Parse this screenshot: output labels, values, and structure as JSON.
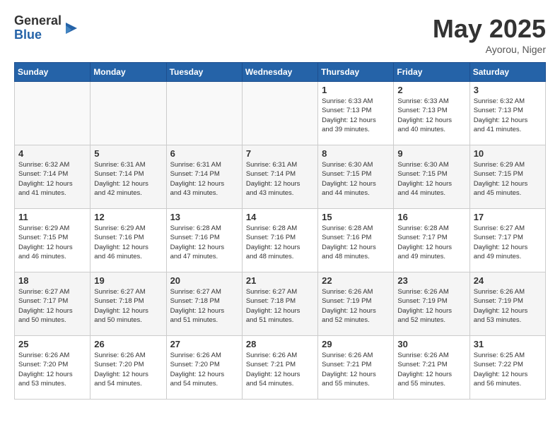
{
  "header": {
    "logo_general": "General",
    "logo_blue": "Blue",
    "month_title": "May 2025",
    "location": "Ayorou, Niger"
  },
  "days_of_week": [
    "Sunday",
    "Monday",
    "Tuesday",
    "Wednesday",
    "Thursday",
    "Friday",
    "Saturday"
  ],
  "weeks": [
    [
      {
        "day": "",
        "info": ""
      },
      {
        "day": "",
        "info": ""
      },
      {
        "day": "",
        "info": ""
      },
      {
        "day": "",
        "info": ""
      },
      {
        "day": "1",
        "info": "Sunrise: 6:33 AM\nSunset: 7:13 PM\nDaylight: 12 hours\nand 39 minutes."
      },
      {
        "day": "2",
        "info": "Sunrise: 6:33 AM\nSunset: 7:13 PM\nDaylight: 12 hours\nand 40 minutes."
      },
      {
        "day": "3",
        "info": "Sunrise: 6:32 AM\nSunset: 7:13 PM\nDaylight: 12 hours\nand 41 minutes."
      }
    ],
    [
      {
        "day": "4",
        "info": "Sunrise: 6:32 AM\nSunset: 7:14 PM\nDaylight: 12 hours\nand 41 minutes."
      },
      {
        "day": "5",
        "info": "Sunrise: 6:31 AM\nSunset: 7:14 PM\nDaylight: 12 hours\nand 42 minutes."
      },
      {
        "day": "6",
        "info": "Sunrise: 6:31 AM\nSunset: 7:14 PM\nDaylight: 12 hours\nand 43 minutes."
      },
      {
        "day": "7",
        "info": "Sunrise: 6:31 AM\nSunset: 7:14 PM\nDaylight: 12 hours\nand 43 minutes."
      },
      {
        "day": "8",
        "info": "Sunrise: 6:30 AM\nSunset: 7:15 PM\nDaylight: 12 hours\nand 44 minutes."
      },
      {
        "day": "9",
        "info": "Sunrise: 6:30 AM\nSunset: 7:15 PM\nDaylight: 12 hours\nand 44 minutes."
      },
      {
        "day": "10",
        "info": "Sunrise: 6:29 AM\nSunset: 7:15 PM\nDaylight: 12 hours\nand 45 minutes."
      }
    ],
    [
      {
        "day": "11",
        "info": "Sunrise: 6:29 AM\nSunset: 7:15 PM\nDaylight: 12 hours\nand 46 minutes."
      },
      {
        "day": "12",
        "info": "Sunrise: 6:29 AM\nSunset: 7:16 PM\nDaylight: 12 hours\nand 46 minutes."
      },
      {
        "day": "13",
        "info": "Sunrise: 6:28 AM\nSunset: 7:16 PM\nDaylight: 12 hours\nand 47 minutes."
      },
      {
        "day": "14",
        "info": "Sunrise: 6:28 AM\nSunset: 7:16 PM\nDaylight: 12 hours\nand 48 minutes."
      },
      {
        "day": "15",
        "info": "Sunrise: 6:28 AM\nSunset: 7:16 PM\nDaylight: 12 hours\nand 48 minutes."
      },
      {
        "day": "16",
        "info": "Sunrise: 6:28 AM\nSunset: 7:17 PM\nDaylight: 12 hours\nand 49 minutes."
      },
      {
        "day": "17",
        "info": "Sunrise: 6:27 AM\nSunset: 7:17 PM\nDaylight: 12 hours\nand 49 minutes."
      }
    ],
    [
      {
        "day": "18",
        "info": "Sunrise: 6:27 AM\nSunset: 7:17 PM\nDaylight: 12 hours\nand 50 minutes."
      },
      {
        "day": "19",
        "info": "Sunrise: 6:27 AM\nSunset: 7:18 PM\nDaylight: 12 hours\nand 50 minutes."
      },
      {
        "day": "20",
        "info": "Sunrise: 6:27 AM\nSunset: 7:18 PM\nDaylight: 12 hours\nand 51 minutes."
      },
      {
        "day": "21",
        "info": "Sunrise: 6:27 AM\nSunset: 7:18 PM\nDaylight: 12 hours\nand 51 minutes."
      },
      {
        "day": "22",
        "info": "Sunrise: 6:26 AM\nSunset: 7:19 PM\nDaylight: 12 hours\nand 52 minutes."
      },
      {
        "day": "23",
        "info": "Sunrise: 6:26 AM\nSunset: 7:19 PM\nDaylight: 12 hours\nand 52 minutes."
      },
      {
        "day": "24",
        "info": "Sunrise: 6:26 AM\nSunset: 7:19 PM\nDaylight: 12 hours\nand 53 minutes."
      }
    ],
    [
      {
        "day": "25",
        "info": "Sunrise: 6:26 AM\nSunset: 7:20 PM\nDaylight: 12 hours\nand 53 minutes."
      },
      {
        "day": "26",
        "info": "Sunrise: 6:26 AM\nSunset: 7:20 PM\nDaylight: 12 hours\nand 54 minutes."
      },
      {
        "day": "27",
        "info": "Sunrise: 6:26 AM\nSunset: 7:20 PM\nDaylight: 12 hours\nand 54 minutes."
      },
      {
        "day": "28",
        "info": "Sunrise: 6:26 AM\nSunset: 7:21 PM\nDaylight: 12 hours\nand 54 minutes."
      },
      {
        "day": "29",
        "info": "Sunrise: 6:26 AM\nSunset: 7:21 PM\nDaylight: 12 hours\nand 55 minutes."
      },
      {
        "day": "30",
        "info": "Sunrise: 6:26 AM\nSunset: 7:21 PM\nDaylight: 12 hours\nand 55 minutes."
      },
      {
        "day": "31",
        "info": "Sunrise: 6:25 AM\nSunset: 7:22 PM\nDaylight: 12 hours\nand 56 minutes."
      }
    ]
  ]
}
